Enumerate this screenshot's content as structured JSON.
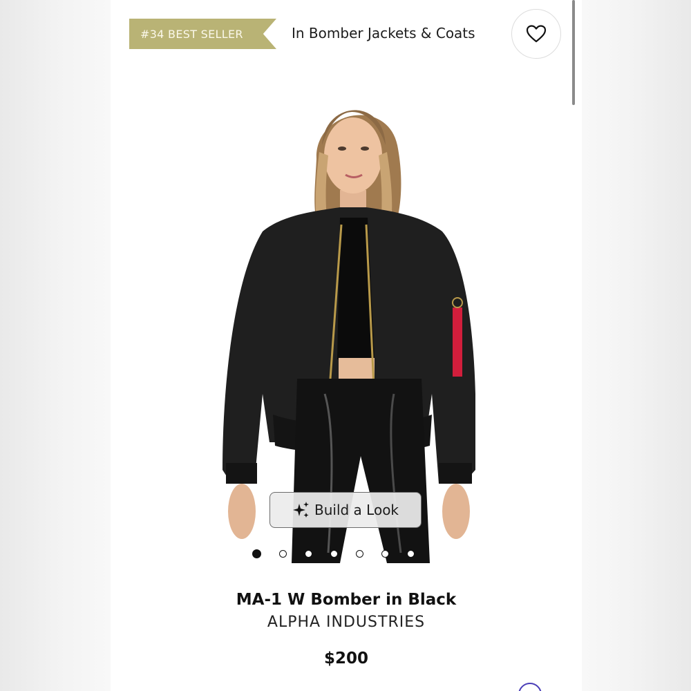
{
  "badge": {
    "text": "#34 BEST SELLER",
    "color": "#b9b375"
  },
  "category": {
    "text": "In Bomber Jackets & Coats"
  },
  "favorite": {
    "icon": "heart-outline-icon"
  },
  "gallery": {
    "total_images": 7,
    "active_index": 0,
    "build_look": {
      "label": "Build a Look",
      "icon": "sparkles-icon"
    }
  },
  "product": {
    "title": "MA-1 W Bomber in Black",
    "brand": "ALPHA INDUSTRIES",
    "price": "$200"
  },
  "colors": {
    "accent_badge": "#b9b375",
    "chat_accent": "#4b3fb8",
    "jacket_tag": "#d21e3c"
  }
}
